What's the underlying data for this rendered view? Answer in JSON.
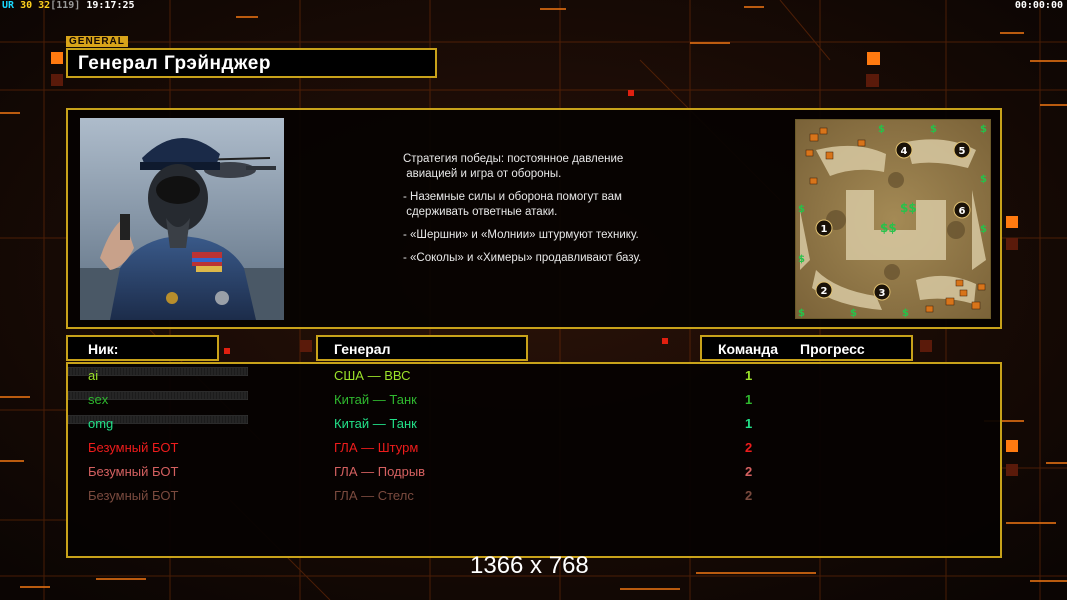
{
  "hud": {
    "ur_label": "UR",
    "fps_a": "30",
    "fps_b": "32",
    "fps_bracket": "[119]",
    "clock": "19:17:25",
    "timer": "00:00:00"
  },
  "header": {
    "tag": "GENERAL",
    "title": "Генерал Грэйнджер"
  },
  "strategy_lines": [
    "Стратегия победы: постоянное давление\n авиацией и игра от обороны.",
    "- Наземные силы и оборона помогут вам\n сдерживать ответные атаки.",
    "- «Шершни» и «Молнии» штурмуют технику.",
    "- «Соколы» и «Химеры» продавливают базу."
  ],
  "columns": {
    "nick": "Ник:",
    "general": "Генерал",
    "team": "Команда",
    "progress": "Прогресс"
  },
  "players": [
    {
      "nick": "ai",
      "general": "США — ВВС",
      "team": "1",
      "color": "#9be22a",
      "progress": 0
    },
    {
      "nick": "sex",
      "general": "Китай — Танк",
      "team": "1",
      "color": "#2fb82f",
      "progress": 0
    },
    {
      "nick": "omg",
      "general": "Китай — Танк",
      "team": "1",
      "color": "#22e088",
      "progress": 0
    },
    {
      "nick": "Безумный БОТ",
      "general": "ГЛА — Штурм",
      "team": "2",
      "color": "#ee1c1c",
      "progress": null
    },
    {
      "nick": "Безумный БОТ",
      "general": "ГЛА — Подрыв",
      "team": "2",
      "color": "#d46060",
      "progress": null
    },
    {
      "nick": "Безумный БОТ",
      "general": "ГЛА — Стелс",
      "team": "2",
      "color": "#7a4a3e",
      "progress": null
    }
  ],
  "minimap": {
    "start_positions": [
      "1",
      "2",
      "3",
      "4",
      "5",
      "6"
    ],
    "resource_symbol": "$"
  },
  "resolution": "1366 x 768",
  "colors": {
    "accent_gold": "#c8a21a",
    "bg_line_orange": "#e07010",
    "hud_ur": "#19d9ff",
    "hud_fps": "#ffd21e"
  }
}
